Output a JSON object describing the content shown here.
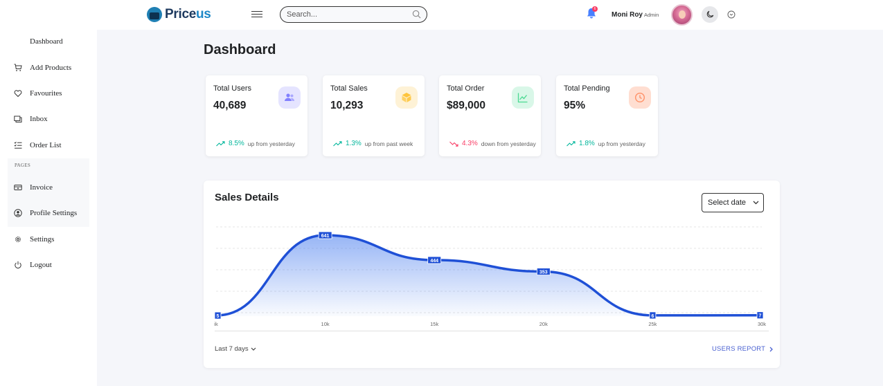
{
  "header": {
    "logo_part1": "Price",
    "logo_part2": "us",
    "search_placeholder": "Search...",
    "notification_count": "6",
    "user_name": "Moni Roy",
    "user_role": "Admin"
  },
  "sidebar": {
    "items": [
      {
        "label": "Dashboard",
        "icon": "none"
      },
      {
        "label": "Add Products",
        "icon": "cart-icon"
      },
      {
        "label": "Favourites",
        "icon": "heart-icon"
      },
      {
        "label": "Inbox",
        "icon": "inbox-icon"
      },
      {
        "label": "Order List",
        "icon": "list-icon"
      }
    ],
    "pages_title": "PAGES",
    "page_items": [
      {
        "label": "Invoice",
        "icon": "invoice-icon"
      },
      {
        "label": "Profile Settings",
        "icon": "user-circle-icon"
      }
    ],
    "bottom_items": [
      {
        "label": "Settings",
        "icon": "gear-icon"
      },
      {
        "label": "Logout",
        "icon": "power-icon"
      }
    ]
  },
  "main": {
    "title": "Dashboard",
    "cards": [
      {
        "label": "Total Users",
        "value": "40,689",
        "pct": "8.5%",
        "text": "up from yesterday",
        "trend": "up",
        "icon": "users-icon",
        "icon_bg": "#e5e4ff",
        "icon_color": "#8280ff"
      },
      {
        "label": "Total Sales",
        "value": "10,293",
        "pct": "1.3%",
        "text": "up from past week",
        "trend": "up",
        "icon": "box-icon",
        "icon_bg": "#fef2d6",
        "icon_color": "#fec53d"
      },
      {
        "label": "Total Order",
        "value": "$89,000",
        "pct": "4.3%",
        "text": "down from yesterday",
        "trend": "down",
        "icon": "chart-line-icon",
        "icon_bg": "#d9f7e8",
        "icon_color": "#4ad991"
      },
      {
        "label": "Total Pending",
        "value": "95%",
        "pct": "1.8%",
        "text": "up from yesterday",
        "trend": "up",
        "icon": "clock-icon",
        "icon_bg": "#ffded1",
        "icon_color": "#ff9066"
      }
    ],
    "sales": {
      "title": "Sales Details",
      "select_label": "Select date",
      "footer_left": "Last 7 days",
      "footer_right": "USERS REPORT"
    }
  },
  "colors": {
    "up": "#00b69b",
    "down": "#f93c65",
    "accent": "#4379ee",
    "line": "#1f50d6"
  },
  "chart_data": {
    "type": "area",
    "x": [
      5000,
      10000,
      15000,
      20000,
      25000,
      30000
    ],
    "values": [
      5,
      641,
      444,
      353,
      6,
      7
    ],
    "point_labels": [
      "5",
      "641",
      "444",
      "353",
      "6",
      "7"
    ],
    "tick_labels": [
      "ik",
      "10k",
      "15k",
      "20k",
      "25k",
      "30k"
    ],
    "ylim": [
      0,
      800
    ],
    "grid": true,
    "title": "Sales Details",
    "xlabel": "",
    "ylabel": ""
  }
}
